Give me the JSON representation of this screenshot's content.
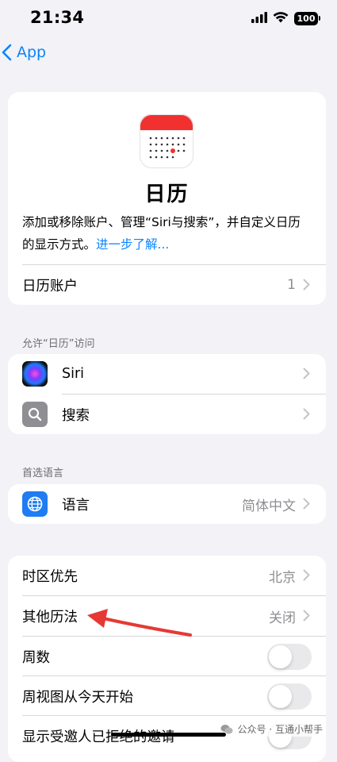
{
  "status_bar": {
    "time": "21:34",
    "battery": "100"
  },
  "nav": {
    "back_label": "App"
  },
  "app_header": {
    "name": "日历",
    "description": "添加或移除账户、管理“Siri与搜索”，并自定义日历的显示方式。",
    "link": "进一步了解..."
  },
  "accounts_row": {
    "label": "日历账户",
    "value": "1"
  },
  "access_section": {
    "header": "允许“日历”访问",
    "items": [
      {
        "label": "Siri"
      },
      {
        "label": "搜索"
      }
    ]
  },
  "language_section": {
    "header": "首选语言",
    "label": "语言",
    "value": "简体中文"
  },
  "settings": {
    "timezone": {
      "label": "时区优先",
      "value": "北京"
    },
    "alt_calendar": {
      "label": "其他历法",
      "value": "关闭"
    },
    "week_numbers": {
      "label": "周数",
      "on": false
    },
    "week_view_today": {
      "label": "周视图从今天开始",
      "on": false
    },
    "show_declined": {
      "label": "显示受邀人已拒绝的邀请",
      "on": false
    }
  },
  "watermark": {
    "text": "公众号 · 互通小帮手"
  },
  "colors": {
    "accent": "#0a84ff",
    "background": "#f2f2f7",
    "annotation_arrow": "#e53935",
    "calendar_red": "#f0312f"
  }
}
